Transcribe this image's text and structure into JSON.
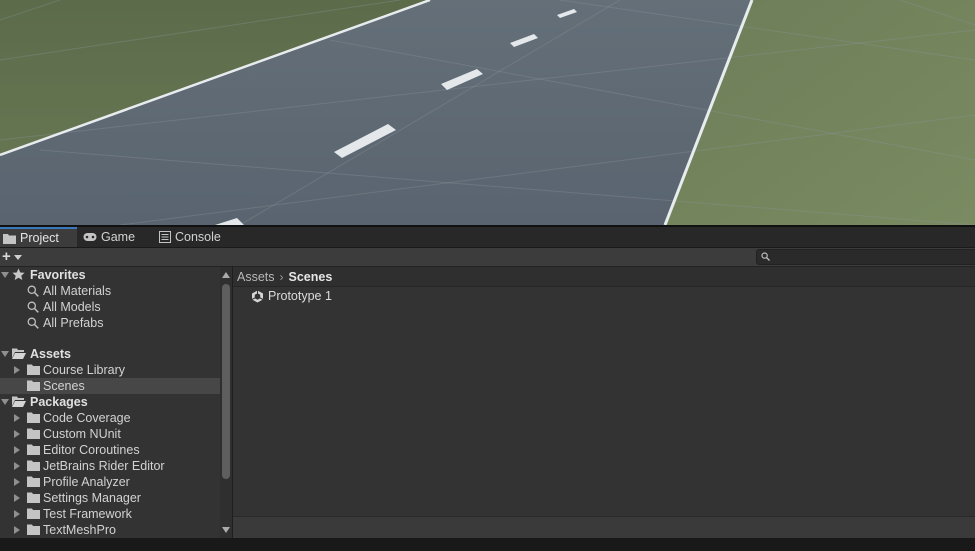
{
  "tabs": [
    {
      "label": "Project",
      "icon": "folder-icon",
      "active": true
    },
    {
      "label": "Game",
      "icon": "gamepad-icon",
      "active": false
    },
    {
      "label": "Console",
      "icon": "console-icon",
      "active": false
    }
  ],
  "toolbar": {
    "add_label": "+",
    "search_placeholder": ""
  },
  "tree": {
    "favorites": {
      "label": "Favorites",
      "items": [
        "All Materials",
        "All Models",
        "All Prefabs"
      ]
    },
    "assets": {
      "label": "Assets",
      "items": [
        "Course Library",
        "Scenes"
      ],
      "selected": "Scenes"
    },
    "packages": {
      "label": "Packages",
      "items": [
        "Code Coverage",
        "Custom NUnit",
        "Editor Coroutines",
        "JetBrains Rider Editor",
        "Profile Analyzer",
        "Settings Manager",
        "Test Framework",
        "TextMeshPro"
      ]
    }
  },
  "breadcrumb": {
    "root": "Assets",
    "separator": "›",
    "current": "Scenes"
  },
  "files": [
    {
      "name": "Prototype 1",
      "icon": "unity-scene-icon"
    }
  ],
  "colors": {
    "accent": "#3a79bb",
    "panel": "#333333",
    "selected": "#474747"
  }
}
